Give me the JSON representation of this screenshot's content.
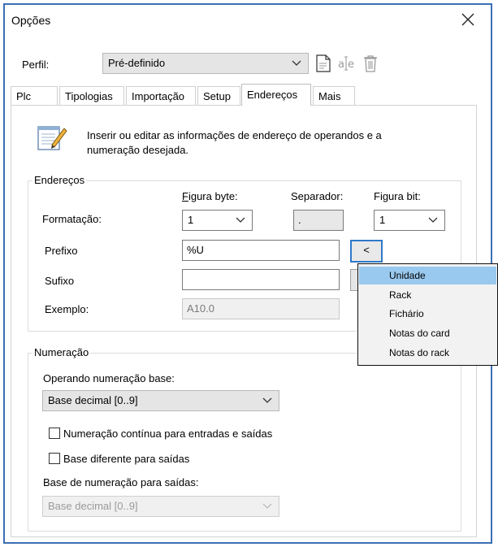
{
  "window": {
    "title": "Opções"
  },
  "profile": {
    "label": "Perfil:",
    "value": "Pré-definido"
  },
  "tabs": [
    {
      "label": "Plc"
    },
    {
      "label": "Tipologias"
    },
    {
      "label": "Importação"
    },
    {
      "label": "Setup"
    },
    {
      "label": "Endereços"
    },
    {
      "label": "Mais"
    }
  ],
  "active_tab": "Endereços",
  "description": {
    "line1": "Inserir ou editar as informações de endereço de operandos e a",
    "line2": "numeração desejada."
  },
  "addresses": {
    "group_label": "Endereços",
    "header_byte": "Figura byte:",
    "header_separator": "Separador:",
    "header_bit": "Figura bit:",
    "format_label": "Formatação:",
    "format_byte_value": "1",
    "format_separator_value": ".",
    "format_bit_value": "1",
    "prefix_label": "Prefixo",
    "prefix_value": "%U",
    "prefix_button": "<",
    "suffix_label": "Sufixo",
    "suffix_value": "",
    "example_label": "Exemplo:",
    "example_value": "A10.0"
  },
  "popup_menu": {
    "items": [
      "Unidade",
      "Rack",
      "Fichário",
      "Notas do card",
      "Notas do rack"
    ],
    "selected": "Unidade"
  },
  "numbering": {
    "group_label": "Numeração",
    "base_operand_label": "Operando numeração base:",
    "base_operand_value": "Base decimal [0..9]",
    "continuous_label": "Numeração contínua para entradas e saídas",
    "continuous_checked": false,
    "different_base_label": "Base diferente para saídas",
    "different_base_checked": false,
    "output_base_label": "Base de numeração para saídas:",
    "output_base_value": "Base decimal [0..9]"
  },
  "icons": {
    "close": "close-icon",
    "new_profile": "new-document-icon",
    "rename_profile": "rename-icon",
    "delete_profile": "trash-icon",
    "description": "notepad-edit-icon"
  },
  "colors": {
    "window_border": "#3c6fb4",
    "selection": "#99c9ef",
    "focus_border": "#2f78c8"
  }
}
